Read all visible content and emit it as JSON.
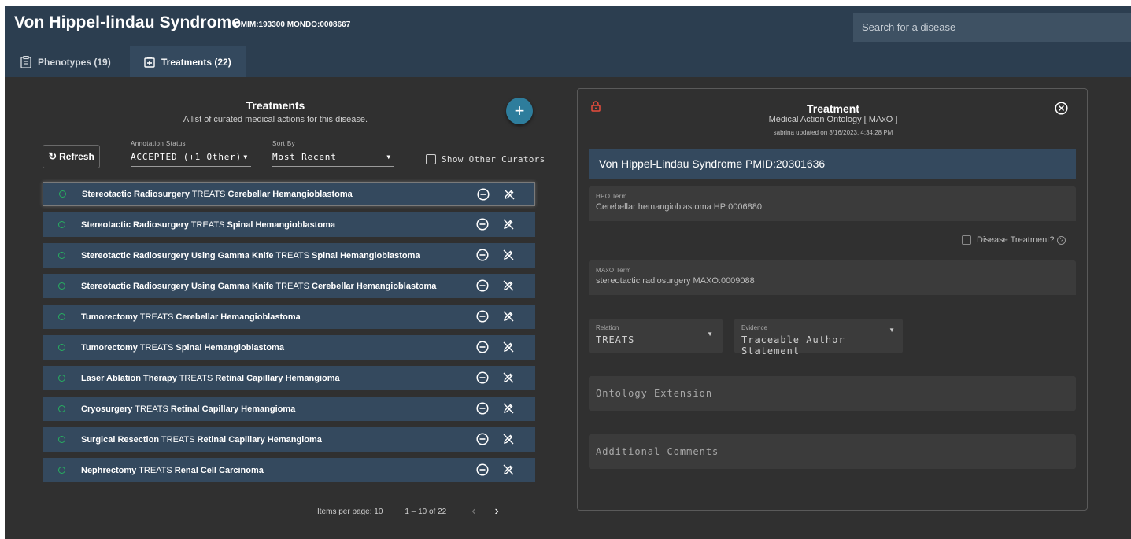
{
  "header": {
    "title": "Von Hippel-lindau Syndrome",
    "ids": "OMIM:193300 MONDO:0008667",
    "search_placeholder": "Search for a disease"
  },
  "tabs": [
    {
      "label": "Phenotypes (19)",
      "icon": "clipboard-icon",
      "active": false
    },
    {
      "label": "Treatments (22)",
      "icon": "medical-box-icon",
      "active": true
    }
  ],
  "list": {
    "title": "Treatments",
    "subtitle": "A list of curated medical actions for this disease.",
    "refresh_label": "Refresh",
    "annotation_status": {
      "label": "Annotation Status",
      "value": "ACCEPTED (+1 Other)"
    },
    "sort_by": {
      "label": "Sort By",
      "value": "Most Recent"
    },
    "show_other_curators": "Show Other Curators",
    "rows": [
      {
        "action": "Stereotactic Radiosurgery",
        "relation": "TREATS",
        "target": "Cerebellar Hemangioblastoma"
      },
      {
        "action": "Stereotactic Radiosurgery",
        "relation": "TREATS",
        "target": "Spinal Hemangioblastoma"
      },
      {
        "action": "Stereotactic Radiosurgery Using Gamma Knife",
        "relation": "TREATS",
        "target": "Spinal Hemangioblastoma"
      },
      {
        "action": "Stereotactic Radiosurgery Using Gamma Knife",
        "relation": "TREATS",
        "target": "Cerebellar Hemangioblastoma"
      },
      {
        "action": "Tumorectomy",
        "relation": "TREATS",
        "target": "Cerebellar Hemangioblastoma"
      },
      {
        "action": "Tumorectomy",
        "relation": "TREATS",
        "target": "Spinal Hemangioblastoma"
      },
      {
        "action": "Laser Ablation Therapy",
        "relation": "TREATS",
        "target": "Retinal Capillary Hemangioma"
      },
      {
        "action": "Cryosurgery",
        "relation": "TREATS",
        "target": "Retinal Capillary Hemangioma"
      },
      {
        "action": "Surgical Resection",
        "relation": "TREATS",
        "target": "Retinal Capillary Hemangioma"
      },
      {
        "action": "Nephrectomy",
        "relation": "TREATS",
        "target": "Renal Cell Carcinoma"
      }
    ],
    "pager": {
      "items_per_page": "Items per page: 10",
      "range": "1 – 10 of 22"
    }
  },
  "detail": {
    "title": "Treatment",
    "subtitle": "Medical Action Ontology [ MAxO ]",
    "updated": "sabrina updated on 3/16/2023, 4:34:28 PM",
    "heading": "Von Hippel-Lindau Syndrome PMID:20301636",
    "hpo": {
      "label": "HPO Term",
      "value": "Cerebellar hemangioblastoma HP:0006880"
    },
    "disease_treatment": "Disease Treatment?",
    "maxo": {
      "label": "MAxO Term",
      "value": "stereotactic radiosurgery MAXO:0009088"
    },
    "relation": {
      "label": "Relation",
      "value": "TREATS"
    },
    "evidence": {
      "label": "Evidence",
      "value": "Traceable Author Statement"
    },
    "ontology_extension": "Ontology Extension",
    "additional_comments": "Additional Comments"
  },
  "colors": {
    "header": "#2c3e50",
    "row": "#34495e",
    "accent": "#2e7d9c",
    "status_dot": "#27ae60",
    "lock": "#e74c3c"
  }
}
